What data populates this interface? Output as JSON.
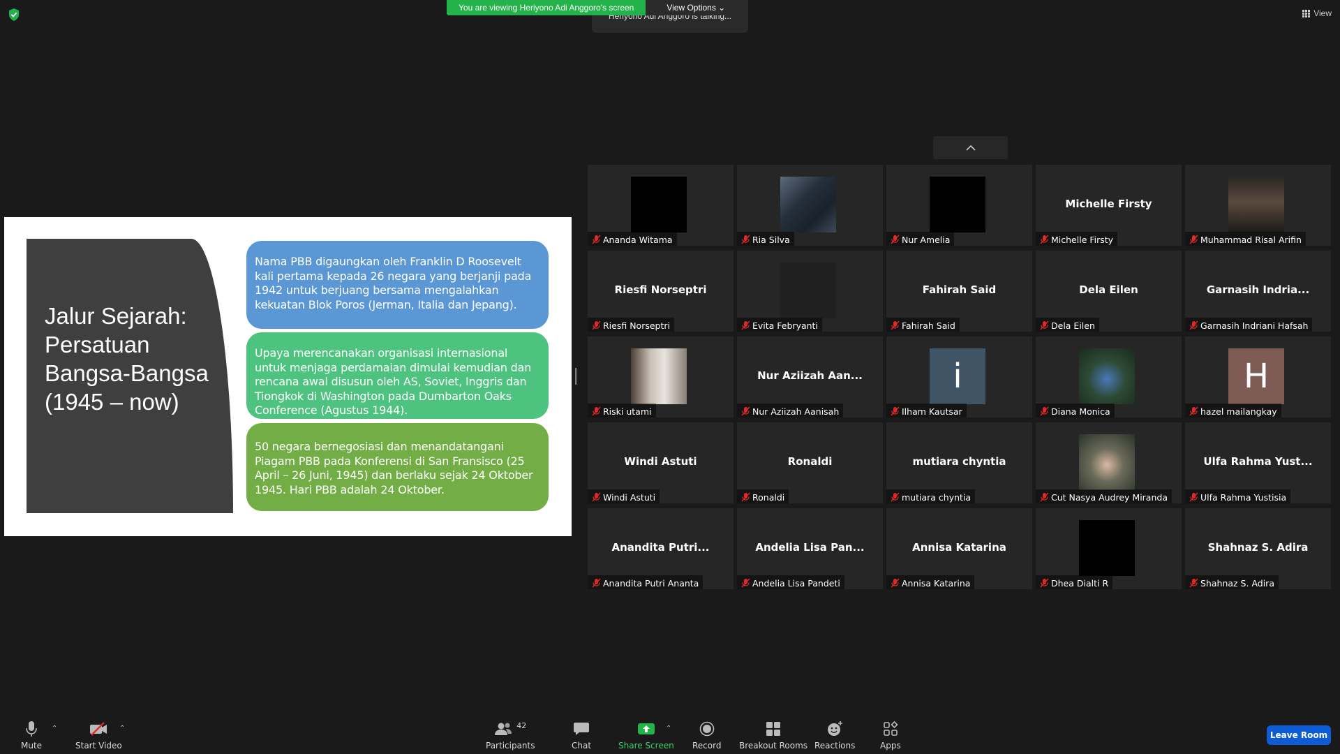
{
  "top": {
    "banner_text": "You are viewing Heriyono Adi Anggoro's screen",
    "view_options_label": "View Options",
    "talking_text": "Heriyono Adi Anggoro is talking...",
    "view_label": "View"
  },
  "slide": {
    "title": "Jalur Sejarah: Persatuan Bangsa-Bangsa (1945 – now)",
    "box1": "Nama PBB digaungkan oleh Franklin D Roosevelt kali pertama kepada 26 negara yang berjanji pada 1942 untuk berjuang bersama mengalahkan kekuatan Blok Poros (Jerman, Italia dan Jepang).",
    "box2": "Upaya merencanakan organisasi internasional untuk menjaga perdamaian dimulai kemudian dan rencana awal disusun oleh AS, Soviet, Inggris dan Tiongkok di Washington pada Dumbarton Oaks Conference (Agustus 1944).",
    "box3": "50 negara bernegosiasi dan menandatangani Piagam PBB pada Konferensi di San Fransisco (25 April – 26 Juni, 1945) dan berlaku sejak 24 Oktober 1945. Hari PBB adalah 24 Oktober."
  },
  "participants": [
    {
      "name": "Ananda Witama",
      "display": "",
      "kind": "black"
    },
    {
      "name": "Ria Silva",
      "display": "",
      "kind": "photo-dark"
    },
    {
      "name": "Nur Amelia",
      "display": "",
      "kind": "black"
    },
    {
      "name": "Michelle Firsty",
      "display": "Michelle Firsty",
      "kind": "text"
    },
    {
      "name": "Muhammad Risal Arifin",
      "display": "",
      "kind": "photo-street"
    },
    {
      "name": "Riesfi Norseptri",
      "display": "Riesfi Norseptri",
      "kind": "text"
    },
    {
      "name": "Evita Febryanti",
      "display": "",
      "kind": "video-dim"
    },
    {
      "name": "Fahirah Said",
      "display": "Fahirah Said",
      "kind": "text"
    },
    {
      "name": "Dela Eilen",
      "display": "Dela Eilen",
      "kind": "text"
    },
    {
      "name": "Garnasih Indriani Hafsah",
      "display": "Garnasih  Indria...",
      "kind": "text"
    },
    {
      "name": "Riski utami",
      "display": "",
      "kind": "photo-room"
    },
    {
      "name": "Nur Aziizah Aanisah",
      "display": "Nur Aziizah Aan...",
      "kind": "text"
    },
    {
      "name": "Ilham Kautsar",
      "display": "i",
      "kind": "letter",
      "color": "#3f5566"
    },
    {
      "name": "Diana Monica",
      "display": "",
      "kind": "photo-flowers"
    },
    {
      "name": "hazel mailangkay",
      "display": "H",
      "kind": "letter",
      "color": "#7e5c55"
    },
    {
      "name": "Windi Astuti",
      "display": "Windi Astuti",
      "kind": "text"
    },
    {
      "name": "Ronaldi",
      "display": "Ronaldi",
      "kind": "text"
    },
    {
      "name": "mutiara chyntia",
      "display": "mutiara chyntia",
      "kind": "text"
    },
    {
      "name": "Cut Nasya Audrey Miranda",
      "display": "",
      "kind": "photo-hijab"
    },
    {
      "name": "Ulfa Rahma Yustisia",
      "display": "Ulfa Rahma Yust...",
      "kind": "text"
    },
    {
      "name": "Anandita Putri Ananta",
      "display": "Anandita  Putri...",
      "kind": "text"
    },
    {
      "name": "Andelia Lisa Pandeti",
      "display": "Andelia Lisa Pan...",
      "kind": "text"
    },
    {
      "name": "Annisa Katarina",
      "display": "Annisa Katarina",
      "kind": "text"
    },
    {
      "name": "Dhea Dialti R",
      "display": "",
      "kind": "black"
    },
    {
      "name": "Shahnaz S. Adira",
      "display": "Shahnaz S. Adira",
      "kind": "text"
    }
  ],
  "toolbar": {
    "mute": "Mute",
    "start_video": "Start Video",
    "participants": "Participants",
    "participants_count": "42",
    "chat": "Chat",
    "share_screen": "Share Screen",
    "record": "Record",
    "breakout": "Breakout Rooms",
    "reactions": "Reactions",
    "apps": "Apps",
    "leave": "Leave Room"
  },
  "colors": {
    "banner_green": "#24b24a",
    "share_green": "#24b24a",
    "leave_blue": "#0e5bd6",
    "mute_red": "#e02828",
    "box_blue": "#5b97d5",
    "box_teal": "#4ec27f",
    "box_green": "#72ae45",
    "slide_dark": "#3f3f3f"
  }
}
